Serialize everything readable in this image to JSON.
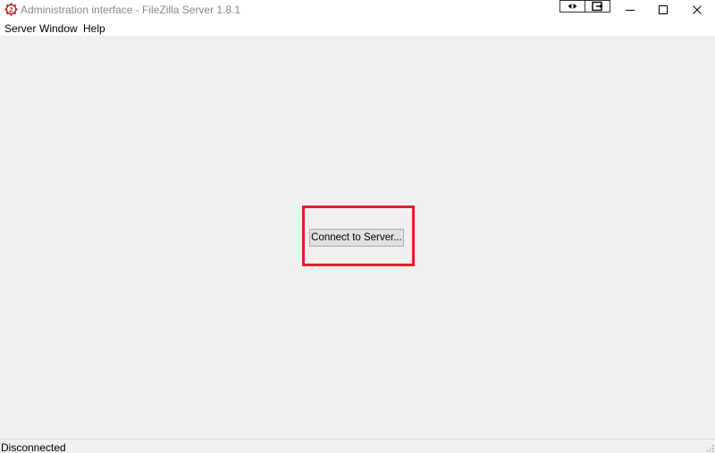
{
  "window": {
    "title": "Administration interface - FileZilla Server 1.8.1",
    "app_icon": "filezilla-server-icon",
    "title_color": "#888888",
    "toolbar_buttons": [
      {
        "icon": "swap-arrows-icon"
      },
      {
        "icon": "exit-box-icon"
      }
    ],
    "controls": {
      "minimize": "minimize-icon",
      "maximize": "maximize-icon",
      "close": "close-icon"
    }
  },
  "menu": {
    "items": [
      "Server",
      "Window",
      "Help"
    ]
  },
  "main": {
    "connect_label": "Connect to Server...",
    "highlight_color": "#e0202b",
    "background": "#f0f0f0"
  },
  "status": {
    "text": "Disconnected"
  }
}
